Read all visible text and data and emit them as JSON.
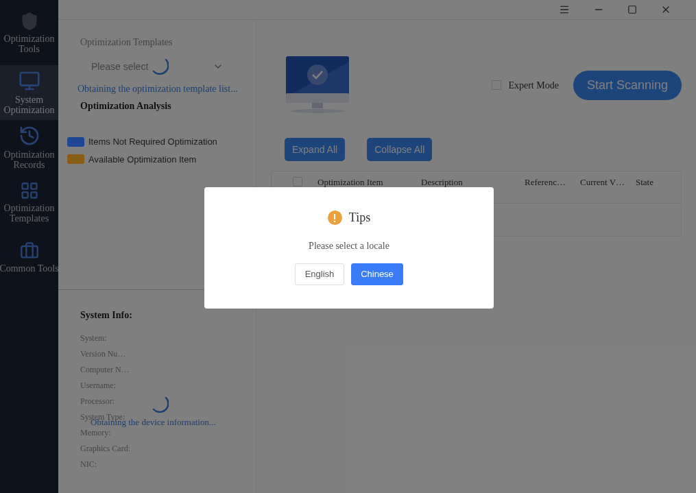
{
  "sidebar": {
    "items": [
      {
        "label": "Optimization Tools",
        "selected": false
      },
      {
        "label": "System Optimization",
        "selected": true
      },
      {
        "label": "Optimization Records",
        "selected": false
      },
      {
        "label": "Optimization Templates",
        "selected": false
      },
      {
        "label": "Common Tools",
        "selected": false
      }
    ]
  },
  "templates": {
    "title": "Optimization Templates",
    "select": {
      "placeholder": "Please select"
    },
    "loading": "Obtaining the optimization template list..."
  },
  "analysis": {
    "title": "Optimization Analysis",
    "legend": [
      {
        "label": "Items Not Required Optimization",
        "color": "#1f4596"
      },
      {
        "label": "Available Optimization Item",
        "color": "#8a5d14"
      }
    ]
  },
  "system_info": {
    "title": "System Info:",
    "fields": [
      "System:",
      "Version Nu…",
      "Computer N…",
      "Username:",
      "Processor:",
      "System Type:",
      "Memory:",
      "Graphics Card:",
      "NIC:"
    ],
    "loading": "Obtaining the device information..."
  },
  "expert_mode": {
    "label": "Expert Mode",
    "checked": false
  },
  "start_button": "Start Scanning",
  "toolbar": [
    "Expand All",
    "Collapse All"
  ],
  "table": {
    "select_all": false,
    "columns": [
      "Optimization Item",
      "Description",
      "Referenc…",
      "Current V…",
      "State"
    ]
  },
  "dialog": {
    "title": "Tips",
    "message": "Please select a locale",
    "buttons": [
      {
        "label": "English",
        "primary": false
      },
      {
        "label": "Chinese",
        "primary": true
      }
    ]
  }
}
